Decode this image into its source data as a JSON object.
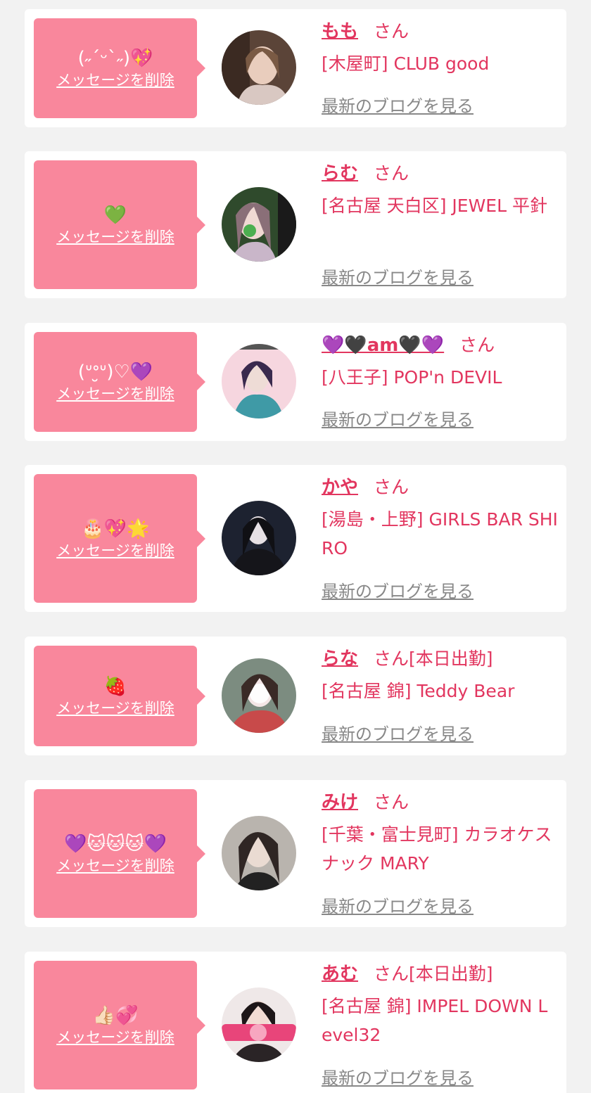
{
  "messages": [
    {
      "bubble_text": "(˶ˊᵕˋ˶)💖",
      "delete_label": "メッセージを削除",
      "name": "もも",
      "honorific": "さん",
      "working_today": "",
      "shop": "[木屋町] CLUB good",
      "blog_label": "最新のブログを見る"
    },
    {
      "bubble_text": "💚",
      "delete_label": "メッセージを削除",
      "name": "らむ",
      "honorific": "さん",
      "working_today": "",
      "shop": "[名古屋 天白区] JEWEL 平針",
      "blog_label": "最新のブログを見る"
    },
    {
      "bubble_text": "(ᐡᐤ̮ᐡ)♡💜",
      "delete_label": "メッセージを削除",
      "name": "💜🖤am🖤💜",
      "honorific": "さん",
      "working_today": "",
      "shop": "[八王子] POP'n DEVIL",
      "blog_label": "最新のブログを見る"
    },
    {
      "bubble_text": "🎂💖🌟",
      "delete_label": "メッセージを削除",
      "name": "かや",
      "honorific": "さん",
      "working_today": "",
      "shop": "[湯島・上野] GIRLS BAR SHIRO",
      "blog_label": "最新のブログを見る"
    },
    {
      "bubble_text": "🍓",
      "delete_label": "メッセージを削除",
      "name": "らな",
      "honorific": "さん",
      "working_today": "[本日出勤]",
      "shop": "[名古屋 錦] Teddy Bear",
      "blog_label": "最新のブログを見る"
    },
    {
      "bubble_text": "💜🐱🐱🐱💜",
      "delete_label": "メッセージを削除",
      "name": "みけ",
      "honorific": "さん",
      "working_today": "",
      "shop": "[千葉・富士見町] カラオケスナック MARY",
      "blog_label": "最新のブログを見る"
    },
    {
      "bubble_text": "👍🏻💞",
      "delete_label": "メッセージを削除",
      "name": "あむ",
      "honorific": "さん",
      "working_today": "[本日出勤]",
      "shop": "[名古屋 錦] IMPEL DOWN Level32",
      "blog_label": "最新のブログを見る"
    }
  ],
  "colors": {
    "accent": "#e2365f",
    "bubble": "#f9879c",
    "page_bg": "#f2f2f2",
    "card_bg": "#ffffff",
    "link_gray": "#888888"
  }
}
